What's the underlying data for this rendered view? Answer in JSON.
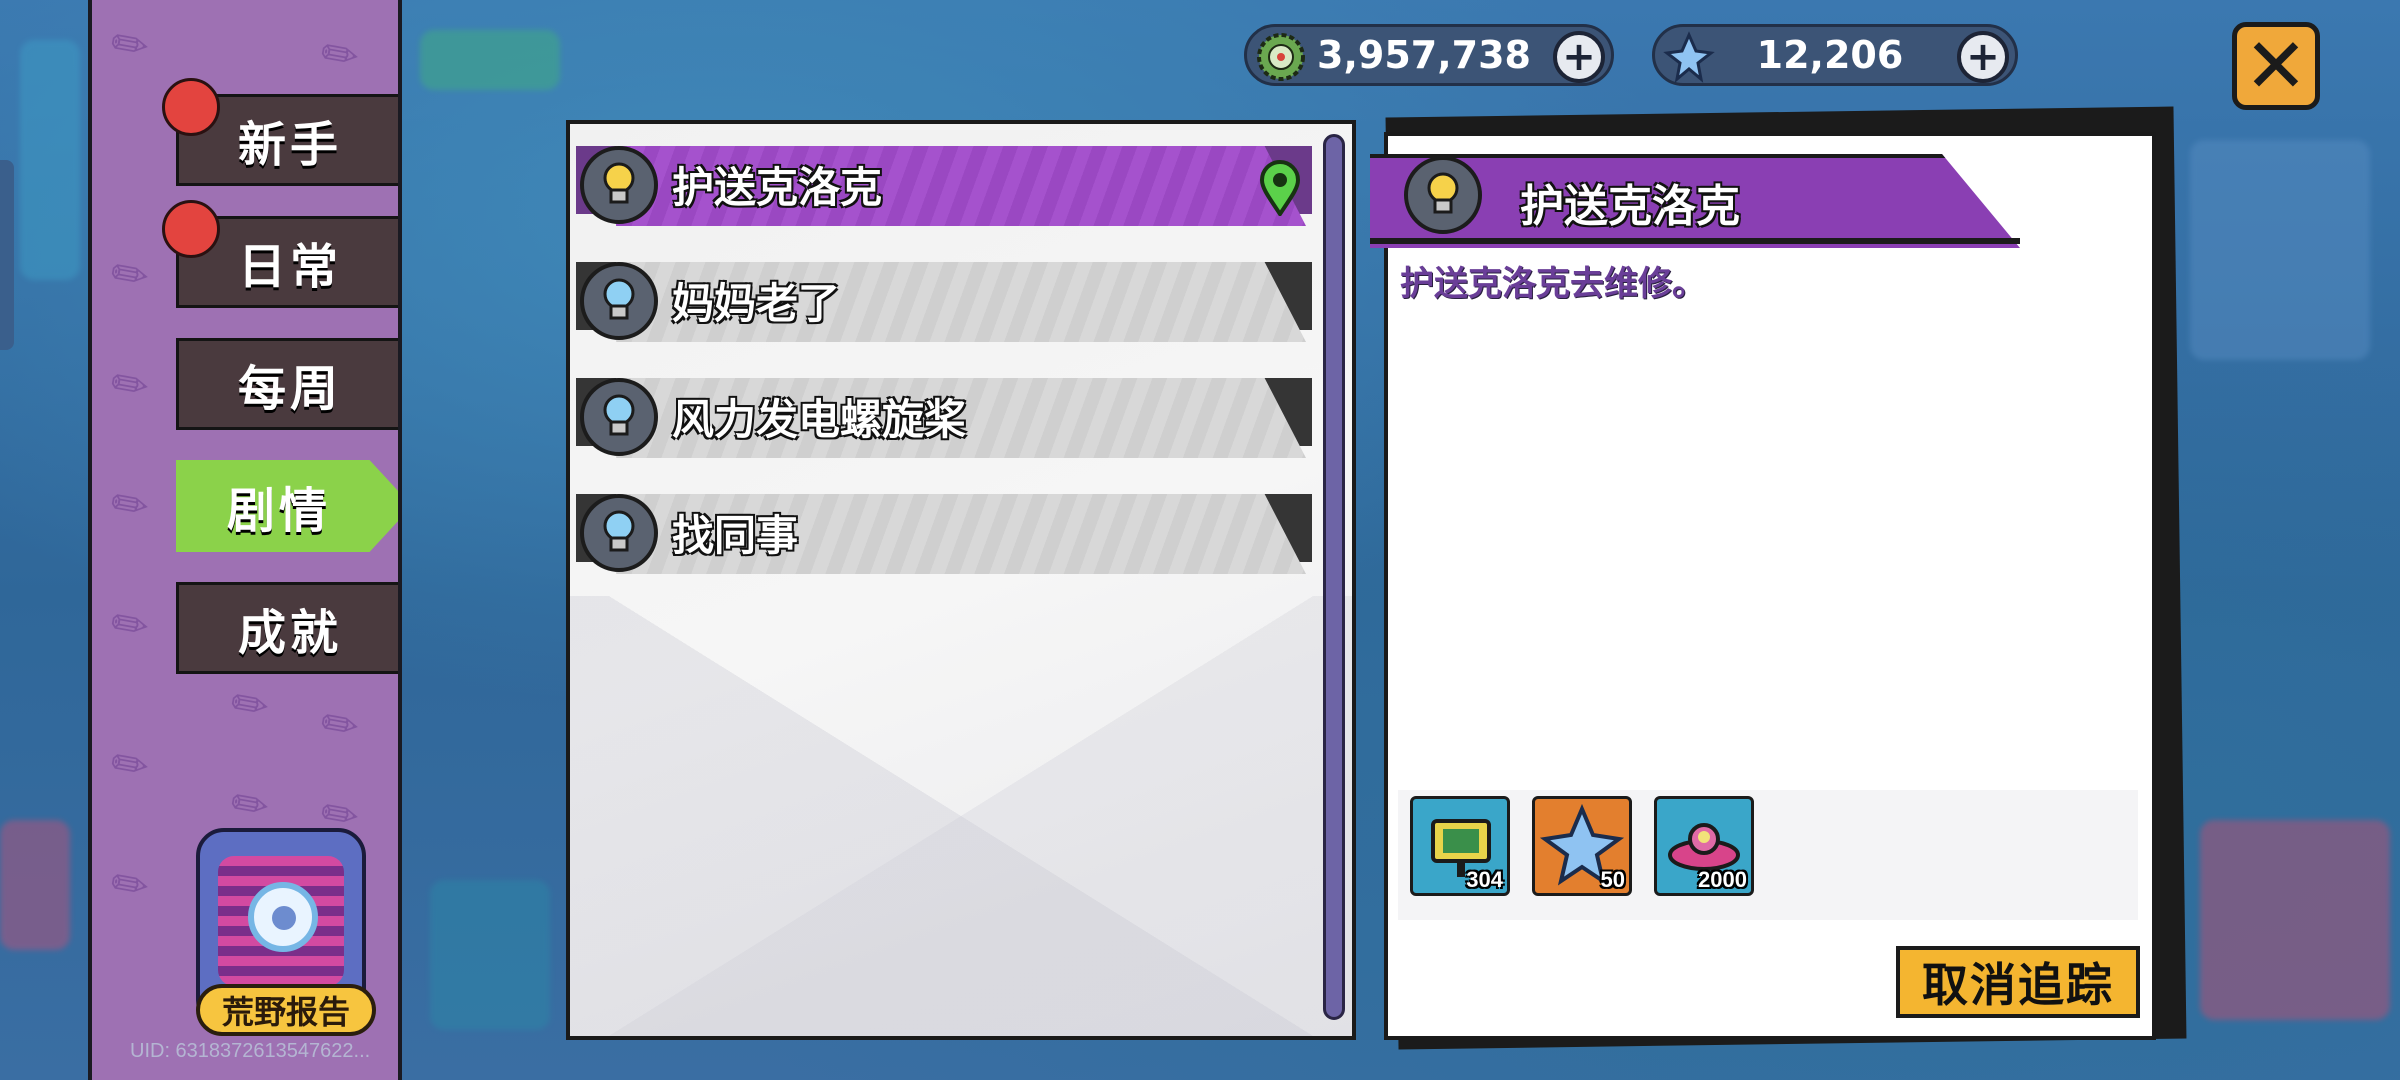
{
  "currencies": [
    {
      "icon": "bottle-cap-icon",
      "value": "3,957,738"
    },
    {
      "icon": "blue-crystal-icon",
      "value": "12,206"
    }
  ],
  "sidebar": {
    "tabs": [
      {
        "label": "新手",
        "has_badge": true,
        "active": false
      },
      {
        "label": "日常",
        "has_badge": true,
        "active": false
      },
      {
        "label": "每周",
        "has_badge": false,
        "active": false
      },
      {
        "label": "剧情",
        "has_badge": false,
        "active": true
      },
      {
        "label": "成就",
        "has_badge": false,
        "active": false
      }
    ],
    "report_label": "荒野报告",
    "uid": "UID: 6318372613547622..."
  },
  "quest_list": [
    {
      "title": "护送克洛克",
      "selected": true,
      "tracked": true
    },
    {
      "title": "妈妈老了",
      "selected": false,
      "tracked": false
    },
    {
      "title": "风力发电螺旋桨",
      "selected": false,
      "tracked": false
    },
    {
      "title": "找同事",
      "selected": false,
      "tracked": false
    }
  ],
  "detail": {
    "title": "护送克洛克",
    "description": "护送克洛克去维修。",
    "rewards": [
      {
        "icon": "monitor-device-icon",
        "qty": "304"
      },
      {
        "icon": "blue-crystal-icon",
        "qty": "50"
      },
      {
        "icon": "spaceship-toy-icon",
        "qty": "2000"
      }
    ],
    "cancel_label": "取消追踪"
  },
  "colors": {
    "active_tab": "#8bd24a",
    "selected_quest": "#9a48c2",
    "sidebar": "#9e71b3",
    "cancel_button": "#f4b530"
  }
}
